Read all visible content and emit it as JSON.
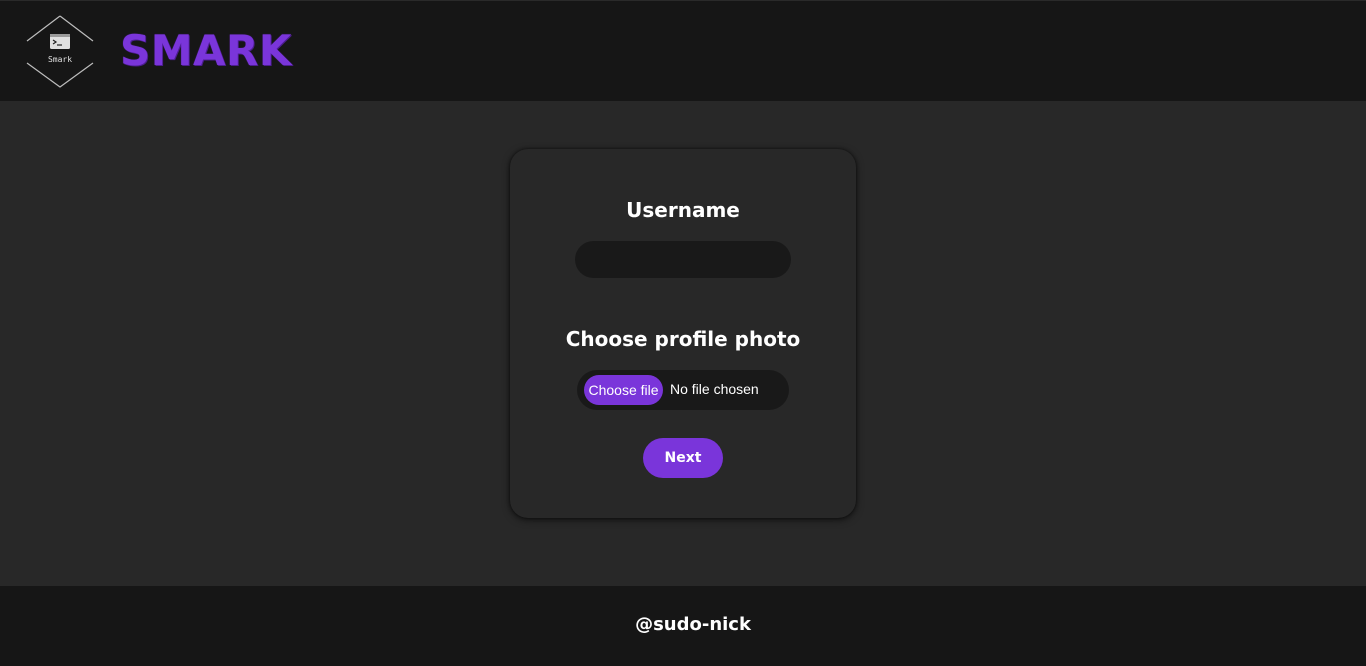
{
  "header": {
    "logo_text": "Smark",
    "logo_icon": "terminal-icon",
    "brand": "SMARK"
  },
  "form": {
    "username_label": "Username",
    "username_value": "",
    "photo_label": "Choose profile photo",
    "file_button_label": "Choose file",
    "file_status": "No file chosen",
    "next_label": "Next"
  },
  "footer": {
    "text": "@sudo-nick"
  },
  "colors": {
    "accent": "#7a35da",
    "header_bg": "#161616",
    "page_bg": "#282828",
    "input_bg": "#191919"
  }
}
